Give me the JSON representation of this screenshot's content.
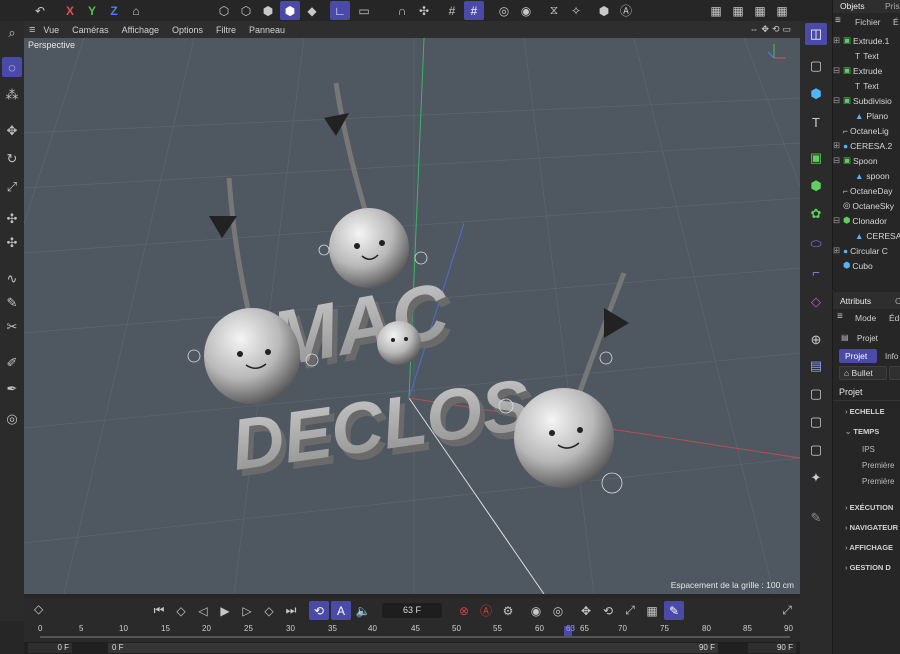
{
  "toolbar": {
    "axis_x": "X",
    "axis_y": "Y",
    "axis_z": "Z"
  },
  "viewport": {
    "menu": [
      "Vue",
      "Caméras",
      "Affichage",
      "Options",
      "Filtre",
      "Panneau"
    ],
    "camera_label": "Perspective",
    "grid_info": "Espacement de la grille : 100 cm",
    "text_line1": "MAC",
    "text_line2": "DECLOS"
  },
  "timeline": {
    "current_frame": "63 F",
    "ticks": [
      "0",
      "5",
      "10",
      "15",
      "20",
      "25",
      "30",
      "35",
      "40",
      "45",
      "50",
      "55",
      "60",
      "63",
      "65",
      "70",
      "75",
      "80",
      "85",
      "90"
    ],
    "start_field": "0 F",
    "start_field2": "0 F",
    "end_field": "90 F",
    "end_field2": "90 F"
  },
  "objects_panel": {
    "tabs": [
      "Objets",
      "Pris"
    ],
    "menu": [
      "Fichier",
      "É"
    ],
    "items": [
      "Extrude.1",
      "Text",
      "Extrude",
      "Text",
      "Subdivisio",
      "Plano",
      "OctaneLig",
      "CERESA.2",
      "Spoon",
      "spoon",
      "OctaneDay",
      "OctaneSky",
      "Clonador",
      "CERESA",
      "Circular C",
      "Cubo"
    ]
  },
  "attributes_panel": {
    "tabs": [
      "Attributs",
      "C"
    ],
    "menu": [
      "Mode",
      "Édi"
    ],
    "object_label": "Projet",
    "subtabs": [
      "Projet",
      "Info"
    ],
    "bullet_label": "Bullet",
    "section_title": "Projet",
    "sections": [
      "ECHELLE",
      "TEMPS",
      "EXÉCUTION",
      "NAVIGATEUR",
      "AFFICHAGE",
      "GESTION D"
    ],
    "temps_fields": [
      "IPS",
      "Première",
      "Première"
    ]
  },
  "colors": {
    "accent": "#4a4aa8",
    "viewport_bg": "#4f5760",
    "axis_x": "#e05050",
    "axis_y": "#50c050",
    "axis_z": "#4a7cff"
  }
}
